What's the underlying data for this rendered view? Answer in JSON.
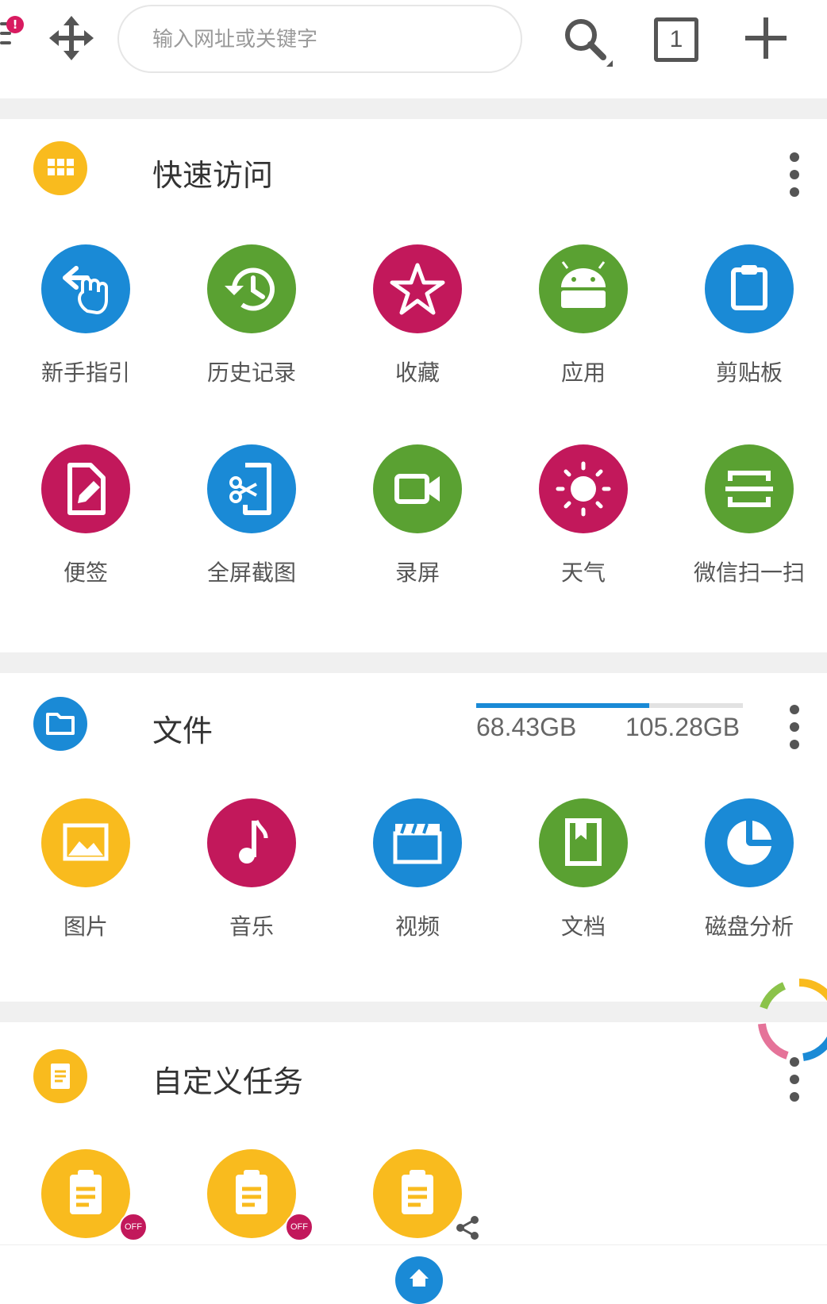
{
  "toolbar": {
    "notification_badge": "!",
    "search_placeholder": "输入网址或关键字",
    "tab_count": "1"
  },
  "quick_access": {
    "title": "快速访问",
    "items": [
      {
        "label": "新手指引",
        "icon": "hand-guide-icon",
        "color": "#1a8ad6"
      },
      {
        "label": "历史记录",
        "icon": "history-icon",
        "color": "#5aa132"
      },
      {
        "label": "收藏",
        "icon": "star-icon",
        "color": "#c2185b"
      },
      {
        "label": "应用",
        "icon": "android-icon",
        "color": "#5aa132"
      },
      {
        "label": "剪贴板",
        "icon": "clipboard-icon",
        "color": "#1a8ad6"
      },
      {
        "label": "便签",
        "icon": "note-icon",
        "color": "#c2185b"
      },
      {
        "label": "全屏截图",
        "icon": "screenshot-icon",
        "color": "#1a8ad6"
      },
      {
        "label": "录屏",
        "icon": "video-camera-icon",
        "color": "#5aa132"
      },
      {
        "label": "天气",
        "icon": "sun-icon",
        "color": "#c2185b"
      },
      {
        "label": "微信扫一扫",
        "icon": "scan-icon",
        "color": "#5aa132"
      }
    ]
  },
  "files": {
    "title": "文件",
    "storage_used": "68.43GB",
    "storage_total": "105.28GB",
    "storage_fraction": 0.65,
    "items": [
      {
        "label": "图片",
        "icon": "image-icon",
        "color": "#f9bb1e"
      },
      {
        "label": "音乐",
        "icon": "music-icon",
        "color": "#c2185b"
      },
      {
        "label": "视频",
        "icon": "clapper-icon",
        "color": "#1a8ad6"
      },
      {
        "label": "文档",
        "icon": "document-icon",
        "color": "#5aa132"
      },
      {
        "label": "磁盘分析",
        "icon": "pie-chart-icon",
        "color": "#1a8ad6"
      }
    ]
  },
  "custom_tasks": {
    "title": "自定义任务",
    "off_label": "OFF",
    "items": [
      {
        "icon": "task-icon",
        "color": "#f9bb1e",
        "status": "OFF"
      },
      {
        "icon": "task-icon",
        "color": "#f9bb1e",
        "status": "OFF"
      },
      {
        "icon": "task-icon",
        "color": "#f9bb1e",
        "status": "share"
      }
    ]
  },
  "colors": {
    "blue": "#1a8ad6",
    "green": "#5aa132",
    "magenta": "#c2185b",
    "yellow": "#f9bb1e"
  }
}
